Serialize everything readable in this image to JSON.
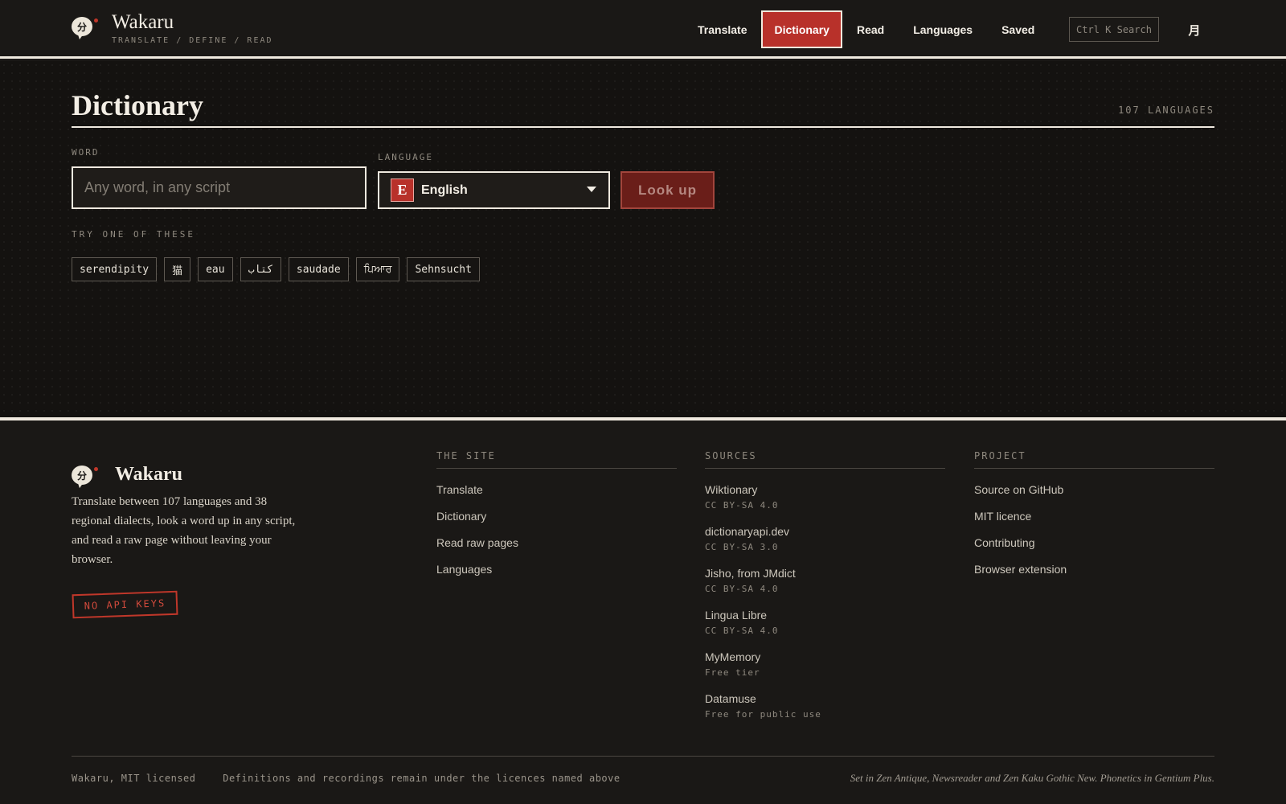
{
  "header": {
    "logo_glyph": "分",
    "brand_name": "Wakaru",
    "tagline": "TRANSLATE / DEFINE / READ",
    "nav": [
      {
        "label": "Translate"
      },
      {
        "label": "Dictionary",
        "active": true
      },
      {
        "label": "Read"
      },
      {
        "label": "Languages"
      },
      {
        "label": "Saved"
      }
    ],
    "search_label": "Ctrl K Search",
    "theme_toggle_glyph": "月"
  },
  "main": {
    "title": "Dictionary",
    "language_count": "107 LANGUAGES",
    "word_label": "WORD",
    "word_placeholder": "Any word, in any script",
    "language_label": "LANGUAGE",
    "language_badge": "E",
    "language_selected": "English",
    "lookup_label": "Look up",
    "try_label": "TRY ONE OF THESE",
    "suggestions": [
      "serendipity",
      "猫",
      "eau",
      "كتاب",
      "saudade",
      "ਪਿਆਰ",
      "Sehnsucht"
    ]
  },
  "footer": {
    "brand_name": "Wakaru",
    "description": "Translate between 107 languages and 38 regional dialects, look a word up in any script, and read a raw page without leaving your browser.",
    "stamp": "NO API KEYS",
    "site": {
      "heading": "THE SITE",
      "links": [
        "Translate",
        "Dictionary",
        "Read raw pages",
        "Languages"
      ]
    },
    "sources": {
      "heading": "SOURCES",
      "items": [
        {
          "name": "Wiktionary",
          "license": "CC BY-SA 4.0"
        },
        {
          "name": "dictionaryapi.dev",
          "license": "CC BY-SA 3.0"
        },
        {
          "name": "Jisho, from JMdict",
          "license": "CC BY-SA 4.0"
        },
        {
          "name": "Lingua Libre",
          "license": "CC BY-SA 4.0"
        },
        {
          "name": "MyMemory",
          "license": "Free tier"
        },
        {
          "name": "Datamuse",
          "license": "Free for public use"
        }
      ]
    },
    "project": {
      "heading": "PROJECT",
      "links": [
        "Source on GitHub",
        "MIT licence",
        "Contributing",
        "Browser extension"
      ]
    },
    "bottom_left_1": "Wakaru, MIT licensed",
    "bottom_left_2": "Definitions and recordings remain under the licences named above",
    "bottom_right": "Set in Zen Antique, Newsreader and Zen Kaku Gothic New. Phonetics in Gentium Plus."
  },
  "colors": {
    "accent": "#b8312a",
    "background": "#1a1816",
    "text": "#ebe6dc"
  }
}
